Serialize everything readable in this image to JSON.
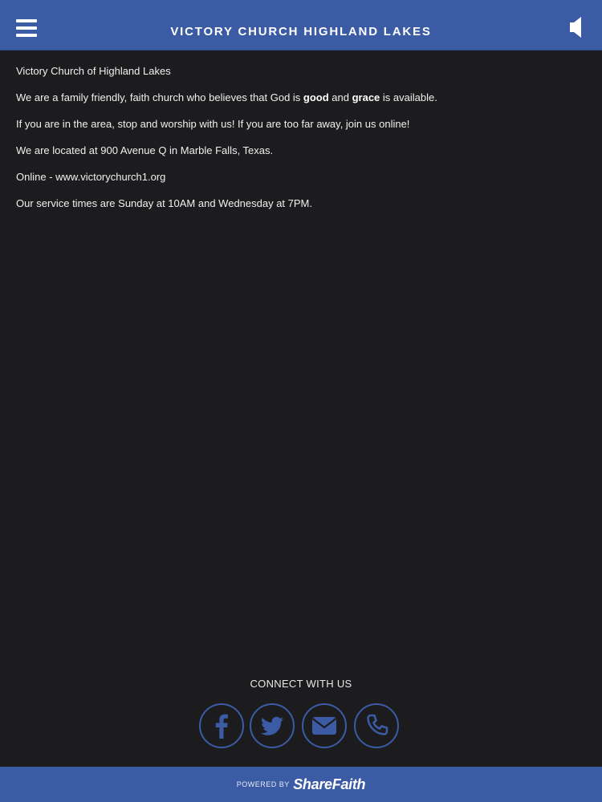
{
  "header": {
    "title": "VICTORY CHURCH HIGHLAND LAKES",
    "menu_icon": "hamburger-menu-icon",
    "audio_icon": "speaker-icon"
  },
  "content": {
    "line1": "Victory Church of Highland Lakes",
    "line2": {
      "pre": "We are a family friendly, faith church who believes that God is ",
      "bold1": "good",
      "mid": " and ",
      "bold2": "grace",
      "post": " is available."
    },
    "line3": "If you are in the area, stop and worship with us! If you are too far away, join us online!",
    "line4": "We are located at 900 Avenue Q in Marble Falls, Texas.",
    "line5": "Online - www.victorychurch1.org",
    "line6": "Our service times are Sunday at 10AM and Wednesday at 7PM."
  },
  "connect": {
    "title": "CONNECT WITH US",
    "icons": [
      "facebook-icon",
      "twitter-icon",
      "email-icon",
      "phone-icon"
    ]
  },
  "footer": {
    "powered_by": "POWERED BY",
    "brand": "ShareFaith"
  },
  "colors": {
    "accent": "#3b5ba5",
    "background": "#1c1c1e",
    "text": "#f0f0f0"
  }
}
